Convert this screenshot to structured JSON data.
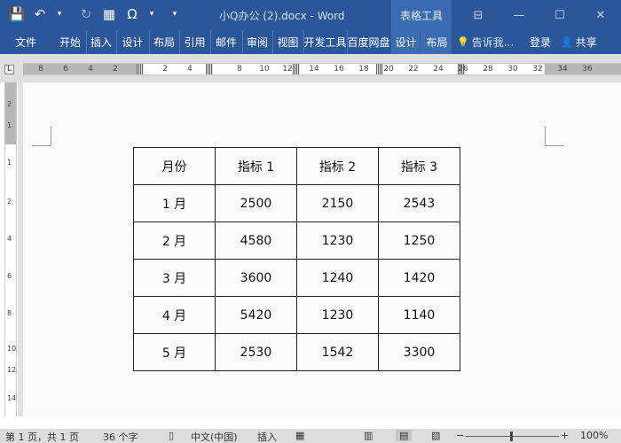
{
  "title_bar": {
    "doc_title": "小Q办公 (2).docx - Word",
    "context_group": "表格工具",
    "icons": [
      "save-icon",
      "undo-icon",
      "redo-icon",
      "format-painter-icon",
      "symbol-icon",
      "customize-qat-icon"
    ],
    "undo_glyph": "↶",
    "redo_glyph": "↻",
    "symbol_glyph": "Ω",
    "dropdown_glyph": "▾",
    "save_glyph": "💾",
    "fmt_glyph": "▦",
    "window_controls": [
      "⊟",
      "—",
      "☐",
      "✕"
    ]
  },
  "ribbon": {
    "tabs": [
      "文件",
      "开始",
      "插入",
      "设计",
      "布局",
      "引用",
      "邮件",
      "审阅",
      "视图",
      "开发工具",
      "百度网盘",
      "设计",
      "布局"
    ],
    "tell_me_icon": "💡",
    "tell_me": "告诉我...",
    "login": "登录",
    "share_icon": "👤",
    "share": "共享"
  },
  "ruler": {
    "corner": "L",
    "h_numbers": [
      "8",
      "6",
      "4",
      "2",
      "2",
      "4",
      "8",
      "10",
      "12",
      "14",
      "16",
      "18",
      "20",
      "22",
      "24",
      "26",
      "28",
      "30",
      "32",
      "34",
      "36"
    ],
    "v_numbers": [
      "2",
      "1",
      "1",
      "2",
      "4",
      "6",
      "8",
      "10",
      "12",
      "14"
    ]
  },
  "table": {
    "header": [
      "月份",
      "指标 1",
      "指标 2",
      "指标 3"
    ],
    "rows": [
      [
        "1 月",
        "2500",
        "2150",
        "2543"
      ],
      [
        "2 月",
        "4580",
        "1230",
        "1250"
      ],
      [
        "3 月",
        "3600",
        "1240",
        "1420"
      ],
      [
        "4 月",
        "5420",
        "1230",
        "1140"
      ],
      [
        "5 月",
        "2530",
        "1542",
        "3300"
      ]
    ]
  },
  "status_bar": {
    "page": "第 1 页，共 1 页",
    "words": "36 个字",
    "language": "中文(中国)",
    "mode": "插入",
    "zoom_minus": "−",
    "zoom_plus": "+",
    "zoom": "100%"
  }
}
